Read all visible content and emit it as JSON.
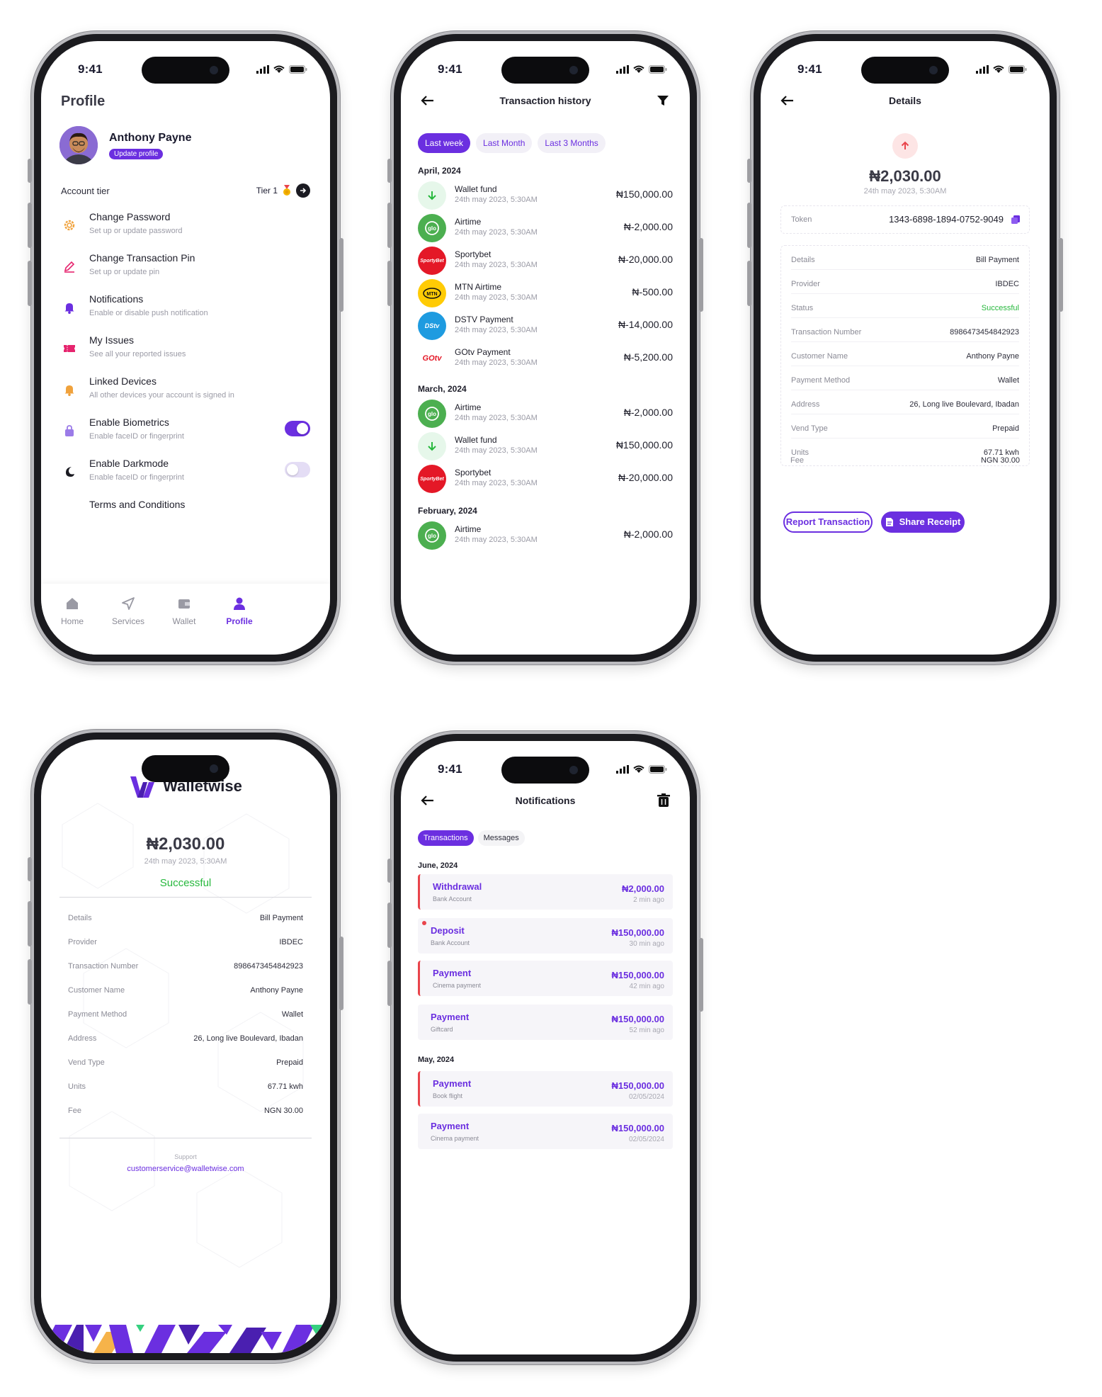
{
  "status": {
    "time": "9:41"
  },
  "profile": {
    "title": "Profile",
    "name": "Anthony Payne",
    "update_label": "Update profile",
    "account_tier_label": "Account tier",
    "tier_value": "Tier 1",
    "menu": [
      {
        "title": "Change Password",
        "subtitle": "Set up or update password",
        "icon": "gear-icon"
      },
      {
        "title": "Change Transaction Pin",
        "subtitle": "Set up or update pin",
        "icon": "pencil-icon"
      },
      {
        "title": "Notifications",
        "subtitle": "Enable or disable push notification",
        "icon": "bell-icon"
      },
      {
        "title": "My Issues",
        "subtitle": "See all your reported issues",
        "icon": "ticket-icon"
      },
      {
        "title": "Linked Devices",
        "subtitle": "All other devices your account is signed in",
        "icon": "bell-orange-icon"
      },
      {
        "title": "Enable Biometrics",
        "subtitle": "Enable faceID or fingerprint",
        "icon": "lock-icon",
        "toggle": true
      },
      {
        "title": "Enable Darkmode",
        "subtitle": "Enable faceID or fingerprint",
        "icon": "moon-icon",
        "toggle": false
      },
      {
        "title": "Terms and Conditions"
      }
    ],
    "tabs": [
      {
        "label": "Home",
        "icon": "home-icon"
      },
      {
        "label": "Services",
        "icon": "send-icon"
      },
      {
        "label": "Wallet",
        "icon": "wallet-icon"
      },
      {
        "label": "Profile",
        "icon": "user-icon",
        "active": true
      }
    ]
  },
  "history": {
    "title": "Transaction history",
    "filters": [
      "Last week",
      "Last Month",
      "Last 3 Months"
    ],
    "active_filter": "Last week",
    "groups": [
      {
        "month": "April, 2024",
        "items": [
          {
            "name": "Wallet fund",
            "date": "24th may 2023, 5:30AM",
            "amount": "₦150,000.00",
            "logo": "wallet-fund"
          },
          {
            "name": "Airtime",
            "date": "24th may 2023, 5:30AM",
            "amount": "₦-2,000.00",
            "logo": "glo"
          },
          {
            "name": "Sportybet",
            "date": "24th may 2023, 5:30AM",
            "amount": "₦-20,000.00",
            "logo": "sportybet"
          },
          {
            "name": "MTN Airtime",
            "date": "24th may 2023, 5:30AM",
            "amount": "₦-500.00",
            "logo": "mtn"
          },
          {
            "name": "DSTV Payment",
            "date": "24th may 2023, 5:30AM",
            "amount": "₦-14,000.00",
            "logo": "dstv"
          },
          {
            "name": "GOtv Payment",
            "date": "24th may 2023, 5:30AM",
            "amount": "₦-5,200.00",
            "logo": "gotv"
          }
        ]
      },
      {
        "month": "March, 2024",
        "items": [
          {
            "name": "Airtime",
            "date": "24th may 2023, 5:30AM",
            "amount": "₦-2,000.00",
            "logo": "glo"
          },
          {
            "name": "Wallet fund",
            "date": "24th may 2023, 5:30AM",
            "amount": "₦150,000.00",
            "logo": "wallet-fund"
          },
          {
            "name": "Sportybet",
            "date": "24th may 2023, 5:30AM",
            "amount": "₦-20,000.00",
            "logo": "sportybet"
          }
        ]
      },
      {
        "month": "February, 2024",
        "items": [
          {
            "name": "Airtime",
            "date": "24th may 2023, 5:30AM",
            "amount": "₦-2,000.00",
            "logo": "glo"
          }
        ]
      }
    ]
  },
  "details": {
    "title": "Details",
    "amount": "₦2,030.00",
    "date": "24th may 2023, 5:30AM",
    "token_label": "Token",
    "token": "1343-6898-1894-0752-9049",
    "rows": [
      {
        "label": "Details",
        "value": "Bill Payment"
      },
      {
        "label": "Provider",
        "value": "IBDEC"
      },
      {
        "label": "Status",
        "value": "Successful"
      },
      {
        "label": "Transaction Number",
        "value": "8986473454842923"
      },
      {
        "label": "Customer Name",
        "value": "Anthony Payne"
      },
      {
        "label": "Payment Method",
        "value": "Wallet"
      },
      {
        "label": "Address",
        "value": "26, Long live Boulevard, Ibadan"
      },
      {
        "label": "Vend Type",
        "value": "Prepaid"
      },
      {
        "label": "Units",
        "value": "67.71 kwh"
      },
      {
        "label": "Fee",
        "value": "NGN 30.00"
      }
    ],
    "report_label": "Report Transaction",
    "share_label": "Share Receipt"
  },
  "receipt": {
    "brand": "Walletwise",
    "amount": "₦2,030.00",
    "date": "24th may 2023, 5:30AM",
    "status": "Successful",
    "rows": [
      {
        "label": "Details",
        "value": "Bill Payment"
      },
      {
        "label": "Provider",
        "value": "IBDEC"
      },
      {
        "label": "Transaction Number",
        "value": "8986473454842923"
      },
      {
        "label": "Customer Name",
        "value": "Anthony Payne"
      },
      {
        "label": "Payment Method",
        "value": "Wallet"
      },
      {
        "label": "Address",
        "value": "26, Long live Boulevard, Ibadan"
      },
      {
        "label": "Vend Type",
        "value": "Prepaid"
      },
      {
        "label": "Units",
        "value": "67.71 kwh"
      },
      {
        "label": "Fee",
        "value": "NGN 30.00"
      }
    ],
    "support_label": "Support",
    "support_email": "customerservice@walletwise.com"
  },
  "notifications": {
    "title": "Notifications",
    "tabs": [
      "Transactions",
      "Messages"
    ],
    "active_tab": "Transactions",
    "groups": [
      {
        "month": "June, 2024",
        "items": [
          {
            "title": "Withdrawal",
            "subtitle": "Bank Account",
            "amount": "₦2,000.00",
            "time": "2 min ago",
            "bar": true,
            "dot": false
          },
          {
            "title": "Deposit",
            "subtitle": "Bank Account",
            "amount": "₦150,000.00",
            "time": "30 min ago",
            "bar": false,
            "dot": true
          },
          {
            "title": "Payment",
            "subtitle": "Cinema payment",
            "amount": "₦150,000.00",
            "time": "42 min ago",
            "bar": true,
            "dot": false
          },
          {
            "title": "Payment",
            "subtitle": "Giftcard",
            "amount": "₦150,000.00",
            "time": "52 min ago",
            "bar": false,
            "dot": false
          }
        ]
      },
      {
        "month": "May, 2024",
        "items": [
          {
            "title": "Payment",
            "subtitle": "Book flight",
            "amount": "₦150,000.00",
            "time": "02/05/2024",
            "bar": true,
            "dot": false
          },
          {
            "title": "Payment",
            "subtitle": "Cinema payment",
            "amount": "₦150,000.00",
            "time": "02/05/2024",
            "bar": false,
            "dot": false
          }
        ]
      }
    ]
  },
  "colors": {
    "accent": "#6b2fe0",
    "success": "#27b83d",
    "danger": "#e9444b"
  }
}
